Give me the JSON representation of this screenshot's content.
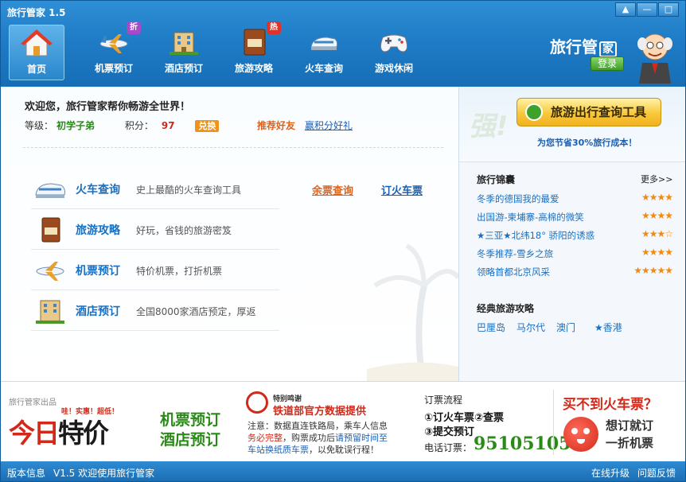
{
  "window": {
    "title": "旅行管家 1.5",
    "controls": {
      "menu": "▲",
      "minimize": "—",
      "maximize": "□",
      "close": "✕"
    }
  },
  "nav": {
    "items": [
      {
        "label": "首页",
        "icon": "home-icon"
      },
      {
        "label": "机票预订",
        "icon": "airplane-icon",
        "badge": "折"
      },
      {
        "label": "酒店预订",
        "icon": "hotel-building-icon"
      },
      {
        "label": "旅游攻略",
        "icon": "guide-book-icon",
        "badge": "热",
        "book_text": "攻略"
      },
      {
        "label": "火车查询",
        "icon": "train-icon"
      },
      {
        "label": "游戏休闲",
        "icon": "gamepad-icon"
      }
    ],
    "badge_colors": {
      "discount": "#a64ac9",
      "hot": "#e0322a"
    }
  },
  "brand": {
    "logo": "旅行管",
    "logo_suffix": "家",
    "login_label": "登录"
  },
  "welcome": {
    "message": "欢迎您，旅行管家帮你畅游全世界！",
    "level_label": "等级：",
    "level_value": "初学子弟",
    "points_label": "积分：",
    "points_value": "97",
    "exchange_label": "兑换",
    "recommend_label": "推荐好友",
    "gift_label": "赢积分好礼"
  },
  "services": [
    {
      "name": "火车查询",
      "desc": "史上最酷的火车查询工具",
      "icon": "train-icon"
    },
    {
      "name": "旅游攻略",
      "desc": "好玩，省钱的旅游密笈",
      "icon": "guide-book-icon",
      "book_text": "攻略"
    },
    {
      "name": "机票预订",
      "desc": "特价机票，打折机票",
      "icon": "airplane-icon"
    },
    {
      "name": "酒店预订",
      "desc": "全国8000家酒店预定，厚返",
      "icon": "hotel-building-icon"
    }
  ],
  "train_links": {
    "remaining": "余票查询",
    "book": "订火车票"
  },
  "right_panel": {
    "query_button": "旅游出行查询工具",
    "save_text": "为您节省30%旅行成本！",
    "deco_text": "强!",
    "tips_title": "旅行锦囊",
    "more_label": "更多>>",
    "guides": [
      {
        "title": "冬季的德国我的最爱",
        "stars": "★★★★"
      },
      {
        "title": "出国游-柬埔寨-高棉的微笑",
        "stars": "★★★★"
      },
      {
        "title": "★三亚★北纬18° 骄阳的诱惑",
        "stars": "★★★☆"
      },
      {
        "title": "冬季推荐-雪乡之旅",
        "stars": "★★★★"
      },
      {
        "title": "领略首都北京风采",
        "stars": "★★★★★"
      }
    ],
    "classic_title": "经典旅游攻略",
    "destinations": [
      "巴厘岛",
      "马尔代",
      "澳门",
      "★香港"
    ]
  },
  "banner": {
    "publisher": "旅行管家出品",
    "today_red": "今日",
    "today_black": "特价",
    "today_sub": "哇！实惠！超低！",
    "air": "机票预订",
    "hotel": "酒店预订",
    "thanks": "特别鸣谢",
    "official": "铁道部官方数据提供",
    "note_1": "注意：数据直连铁路局，乘车人信息",
    "note_2": "务必完整",
    "note_3": "，购票成功后",
    "note_4": "请预留时间至",
    "note_5": "车站换纸质车票",
    "note_6": "，以免耽误行程！",
    "flow_title": "订票流程",
    "step1": "①订火车票②查票",
    "step2": "③提交预订",
    "phone_label": "电话订票：",
    "phone": "95105105",
    "cant_buy": "买不到火车票？",
    "want_book": "想订就订",
    "discount": "一折机票"
  },
  "status": {
    "version_info": "版本信息",
    "welcome_text": "V1.5 欢迎使用旅行管家",
    "online_update": "在线升级",
    "feedback": "问题反馈"
  }
}
